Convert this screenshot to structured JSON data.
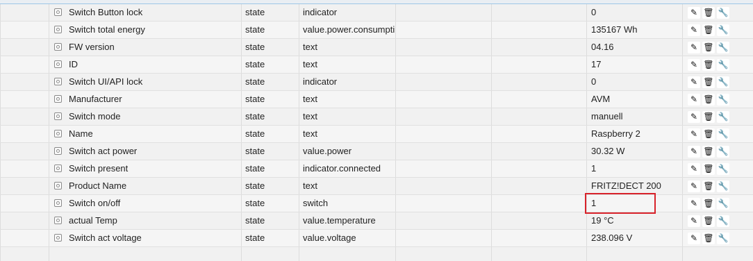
{
  "rows": [
    {
      "name": "Switch Button lock",
      "type": "state",
      "role": "indicator",
      "value": "0"
    },
    {
      "name": "Switch total energy",
      "type": "state",
      "role": "value.power.consumpti",
      "value": "135167 Wh"
    },
    {
      "name": "FW version",
      "type": "state",
      "role": "text",
      "value": "04.16"
    },
    {
      "name": "ID",
      "type": "state",
      "role": "text",
      "value": "17"
    },
    {
      "name": "Switch UI/API lock",
      "type": "state",
      "role": "indicator",
      "value": "0"
    },
    {
      "name": "Manufacturer",
      "type": "state",
      "role": "text",
      "value": "AVM"
    },
    {
      "name": "Switch mode",
      "type": "state",
      "role": "text",
      "value": "manuell"
    },
    {
      "name": "Name",
      "type": "state",
      "role": "text",
      "value": "Raspberry 2"
    },
    {
      "name": "Switch act power",
      "type": "state",
      "role": "value.power",
      "value": "30.32 W"
    },
    {
      "name": "Switch present",
      "type": "state",
      "role": "indicator.connected",
      "value": "1"
    },
    {
      "name": "Product Name",
      "type": "state",
      "role": "text",
      "value": "FRITZ!DECT 200"
    },
    {
      "name": "Switch on/off",
      "type": "state",
      "role": "switch",
      "value": "1"
    },
    {
      "name": "actual Temp",
      "type": "state",
      "role": "value.temperature",
      "value": "19 °C"
    },
    {
      "name": "Switch act voltage",
      "type": "state",
      "role": "value.voltage",
      "value": "238.096 V"
    }
  ],
  "actions": {
    "edit_icon": "pencil-icon",
    "delete_icon": "trash-icon",
    "settings_icon": "wrench-icon",
    "edit_glyph": "✎",
    "delete_glyph": "🗑",
    "settings_glyph": "🔧"
  },
  "highlight_color": "#d8222a"
}
